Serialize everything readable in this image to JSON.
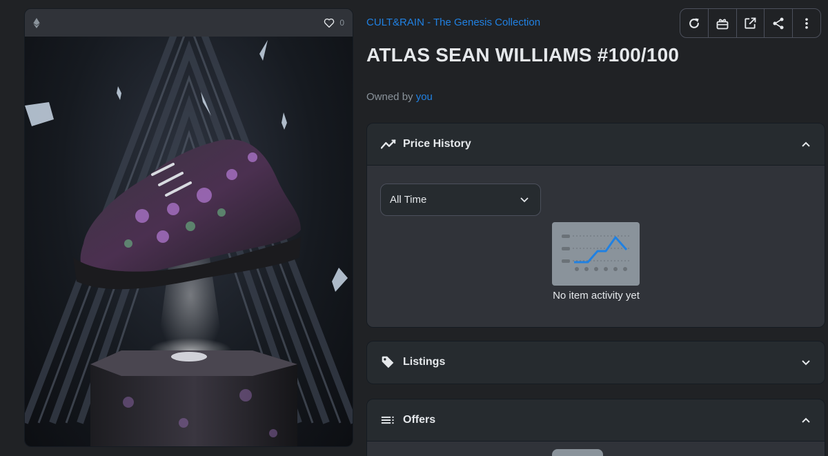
{
  "card": {
    "favorites_count": "0",
    "icons": {
      "chain": "ethereum-icon",
      "favorite": "heart-icon"
    }
  },
  "collection": {
    "name": "CULT&RAIN - The Genesis Collection"
  },
  "asset": {
    "title": "ATLAS SEAN WILLIAMS #100/100"
  },
  "owner": {
    "prefix": "Owned by ",
    "name": "you"
  },
  "toolbar": {
    "buttons": [
      "refresh-icon",
      "gift-icon",
      "external-link-icon",
      "share-icon",
      "more-vertical-icon"
    ]
  },
  "price_history": {
    "title": "Price History",
    "filter_value": "All Time",
    "empty_text": "No item activity yet"
  },
  "listings": {
    "title": "Listings"
  },
  "offers": {
    "title": "Offers"
  },
  "colors": {
    "background": "#202225",
    "panel": "#262b2f",
    "panel_body": "#303339",
    "accent_link": "#2081e2",
    "text": "#e5e8eb",
    "muted": "#8a939b"
  }
}
